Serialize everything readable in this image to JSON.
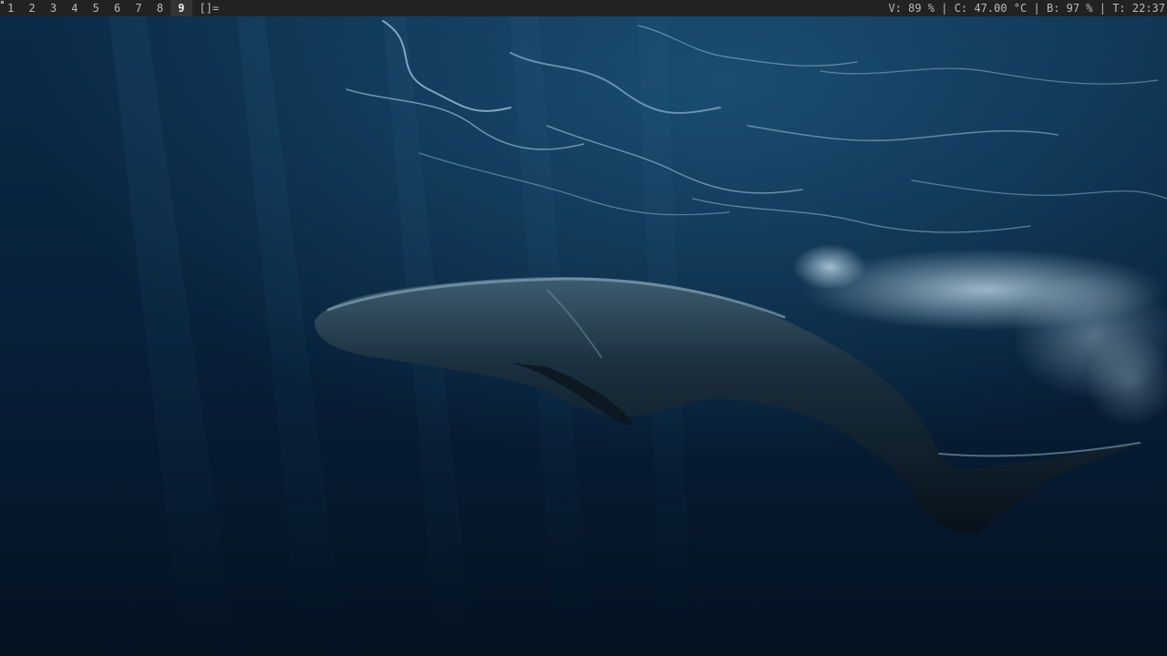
{
  "bar": {
    "tags": [
      "1",
      "2",
      "3",
      "4",
      "5",
      "6",
      "7",
      "8",
      "9"
    ],
    "selected_tag": "9",
    "layout_symbol": "[]=",
    "status": {
      "volume": "V: 89 %",
      "cpu_temp": "C: 47.00 °C",
      "brightness": "B: 97 %",
      "time": "T: 22:37",
      "separator": " | "
    }
  },
  "wallpaper": {
    "subject": "humpback whale underwater",
    "colors": {
      "deep": "#041222",
      "mid": "#0b2a47",
      "surface": "#1f5a80",
      "foam": "#cfe8f4",
      "whale": "#0e1f2c"
    }
  }
}
